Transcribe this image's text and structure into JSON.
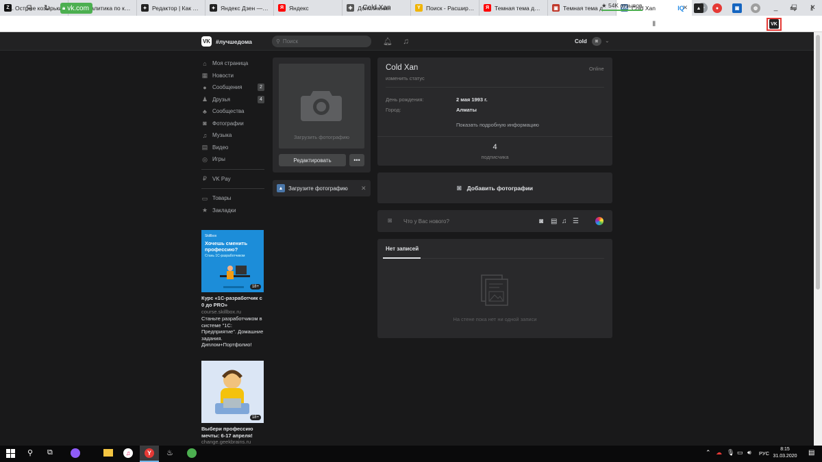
{
  "browser": {
    "tabs": [
      {
        "label": "Острые козырьки",
        "icon": "zen-z-icon",
        "color": "#111111",
        "glyph": "Z"
      },
      {
        "label": "Аналитика по кана",
        "icon": "youtube-icon",
        "color": "#e62117",
        "glyph": "▶"
      },
      {
        "label": "Редактор | Как сде",
        "icon": "zen-star-icon",
        "color": "#222222",
        "glyph": "✦"
      },
      {
        "label": "Яндекс Дзен — пер",
        "icon": "zen-star-icon",
        "color": "#222222",
        "glyph": "✦"
      },
      {
        "label": "Яндекс",
        "icon": "yandex-icon",
        "color": "#ff0000",
        "glyph": "Я"
      },
      {
        "label": "Дополнения",
        "icon": "puzzle-icon",
        "color": "#555555",
        "glyph": "✚"
      },
      {
        "label": "Поиск - Расширени",
        "icon": "yandex-browser-icon",
        "color": "#f0b400",
        "glyph": "Y"
      },
      {
        "label": "Темная тема для В",
        "icon": "yandex-icon",
        "color": "#ff0000",
        "glyph": "Я"
      },
      {
        "label": "Темная тема для В",
        "icon": "page-icon",
        "color": "#c0392b",
        "glyph": "▣"
      },
      {
        "label": "Cold Xan",
        "icon": "vk-icon",
        "color": "#4a76a8",
        "glyph": "VK",
        "active": true
      }
    ],
    "url": "vk.com",
    "page_title": "Cold Xan",
    "reviews": "★ 54K отзывов",
    "yandex_glyph": "Я"
  },
  "vk_header": {
    "logo": "VK",
    "tag": "#лучшедома",
    "search_placeholder": "Поиск",
    "username": "Cold"
  },
  "menu": [
    {
      "label": "Моя страница",
      "icon": "home-icon",
      "glyph": "⌂"
    },
    {
      "label": "Новости",
      "icon": "news-icon",
      "glyph": "▦"
    },
    {
      "label": "Сообщения",
      "icon": "messages-icon",
      "glyph": "●",
      "count": "2"
    },
    {
      "label": "Друзья",
      "icon": "friends-icon",
      "glyph": "♟",
      "count": "4"
    },
    {
      "label": "Сообщества",
      "icon": "communities-icon",
      "glyph": "♣"
    },
    {
      "label": "Фотографии",
      "icon": "photos-icon",
      "glyph": "◙"
    },
    {
      "label": "Музыка",
      "icon": "music-icon",
      "glyph": "♫"
    },
    {
      "label": "Видео",
      "icon": "video-icon",
      "glyph": "▤"
    },
    {
      "label": "Игры",
      "icon": "games-icon",
      "glyph": "◎"
    }
  ],
  "menu2": [
    {
      "label": "VK Pay",
      "icon": "vkpay-icon",
      "glyph": "₽"
    }
  ],
  "menu3": [
    {
      "label": "Товары",
      "icon": "goods-icon",
      "glyph": "▭"
    },
    {
      "label": "Закладки",
      "icon": "bookmarks-icon",
      "glyph": "★"
    }
  ],
  "ads": [
    {
      "brand": "Skillbox",
      "headline": "Хочешь сменить профессию?",
      "sub": "Стань 1С-разработчиком",
      "age": "18+",
      "title": "Курс «1С-разработчик с 0 до PRO»",
      "domain": "course.skillbox.ru",
      "desc": "Станьте разработчиком в системе \"1С: Предприятие\". Домашние задания. Диплом+Портфолио!"
    },
    {
      "age": "18+",
      "title": "Выбери профессию мечты: 6-17 апреля!",
      "domain": "change.geekbrains.ru"
    }
  ],
  "profile": {
    "upload_photo_label": "Загрузить фотографию",
    "edit_button": "Редактировать",
    "more_button": "•••",
    "upload_banner": "Загрузите фотографию",
    "name": "Cold Xan",
    "online": "Online",
    "status": "изменить статус",
    "birthday_label": "День рождения:",
    "birthday": "2 мая 1993 г.",
    "city_label": "Город:",
    "city": "Алматы",
    "more_info": "Показать подробную информацию",
    "subs_count": "4",
    "subs_label": "подписчика",
    "add_photos": "Добавить фотографии",
    "post_placeholder": "Что у Вас нового?",
    "no_posts_tab": "Нет записей",
    "empty_wall": "На стене пока нет ни одной записи"
  },
  "taskbar": {
    "lang": "РУС",
    "time": "8:15",
    "date": "31.03.2020"
  },
  "colors": {
    "vk_dark_bg": "#19191a",
    "vk_card": "#29292b",
    "vk_blue": "#4a76a8",
    "accent_green": "#4caf50"
  }
}
